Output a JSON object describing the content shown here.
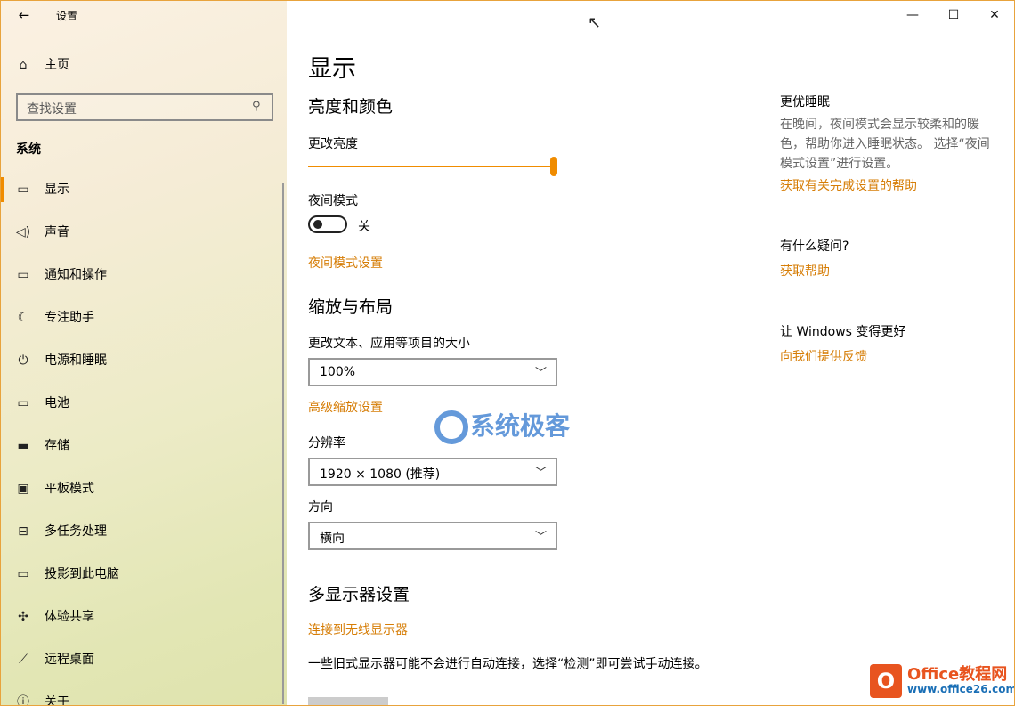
{
  "window": {
    "title": "设置",
    "controls": {
      "minimize": "—",
      "maximize": "☐",
      "close": "✕"
    }
  },
  "sidebar": {
    "home": "主页",
    "search_placeholder": "查找设置",
    "section": "系统",
    "items": [
      {
        "label": "显示",
        "icon": "monitor-icon",
        "glyph": "🖵"
      },
      {
        "label": "声音",
        "icon": "speaker-icon",
        "glyph": "🔊"
      },
      {
        "label": "通知和操作",
        "icon": "notification-icon",
        "glyph": "▭"
      },
      {
        "label": "专注助手",
        "icon": "moon-icon",
        "glyph": "☾"
      },
      {
        "label": "电源和睡眠",
        "icon": "power-icon",
        "glyph": "⏻"
      },
      {
        "label": "电池",
        "icon": "battery-icon",
        "glyph": "▭"
      },
      {
        "label": "存储",
        "icon": "storage-icon",
        "glyph": "▭"
      },
      {
        "label": "平板模式",
        "icon": "tablet-icon",
        "glyph": "▣"
      },
      {
        "label": "多任务处理",
        "icon": "multitask-icon",
        "glyph": "⊟"
      },
      {
        "label": "投影到此电脑",
        "icon": "project-icon",
        "glyph": "▭"
      },
      {
        "label": "体验共享",
        "icon": "share-icon",
        "glyph": "✕"
      },
      {
        "label": "远程桌面",
        "icon": "remote-icon",
        "glyph": "✕"
      },
      {
        "label": "关于",
        "icon": "info-icon",
        "glyph": "ⓘ"
      }
    ]
  },
  "main": {
    "title": "显示",
    "brightness_section": "亮度和颜色",
    "brightness_label": "更改亮度",
    "brightness_level": 1.0,
    "night_mode_label": "夜间模式",
    "night_mode_state": "关",
    "night_mode_link": "夜间模式设置",
    "scale_section": "缩放与布局",
    "scale_label": "更改文本、应用等项目的大小",
    "scale_value": "100%",
    "advanced_scale_link": "高级缩放设置",
    "resolution_label": "分辨率",
    "resolution_value": "1920 × 1080 (推荐)",
    "orientation_label": "方向",
    "orientation_value": "横向",
    "multi_display_section": "多显示器设置",
    "wireless_link": "连接到无线显示器",
    "legacy_desc": "一些旧式显示器可能不会进行自动连接，选择“检测”即可尝试手动连接。"
  },
  "right": {
    "sleep_heading": "更优睡眠",
    "sleep_text": "在晚间，夜间模式会显示较柔和的暖色，帮助你进入睡眠状态。 选择“夜间模式设置”进行设置。",
    "sleep_link": "获取有关完成设置的帮助",
    "question_heading": "有什么疑问?",
    "help_link": "获取帮助",
    "better_heading": "让 Windows 变得更好",
    "feedback_link": "向我们提供反馈"
  },
  "watermarks": {
    "center": "系统极客",
    "office_title": "Office教程网",
    "office_url": "www.office26.com"
  },
  "colors": {
    "accent": "#f08c00",
    "link": "#d67d06"
  }
}
